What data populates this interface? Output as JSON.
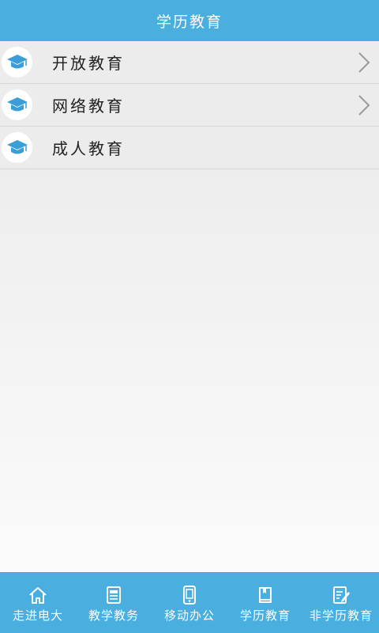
{
  "header": {
    "title": "学历教育"
  },
  "list": {
    "items": [
      {
        "label": "开放教育",
        "icon": "graduation-cap-icon",
        "has_chevron": true
      },
      {
        "label": "网络教育",
        "icon": "graduation-cap-icon",
        "has_chevron": true
      },
      {
        "label": "成人教育",
        "icon": "graduation-cap-icon",
        "has_chevron": false
      }
    ]
  },
  "tabbar": {
    "tabs": [
      {
        "label": "走进电大",
        "icon": "home-icon"
      },
      {
        "label": "教学教务",
        "icon": "document-list-icon"
      },
      {
        "label": "移动办公",
        "icon": "phone-icon"
      },
      {
        "label": "学历教育",
        "icon": "book-icon"
      },
      {
        "label": "非学历教育",
        "icon": "edit-note-icon"
      }
    ]
  },
  "colors": {
    "primary": "#4aaedf",
    "list_background": "#ececec",
    "text": "#222222",
    "icon": "#3a9fd8"
  }
}
